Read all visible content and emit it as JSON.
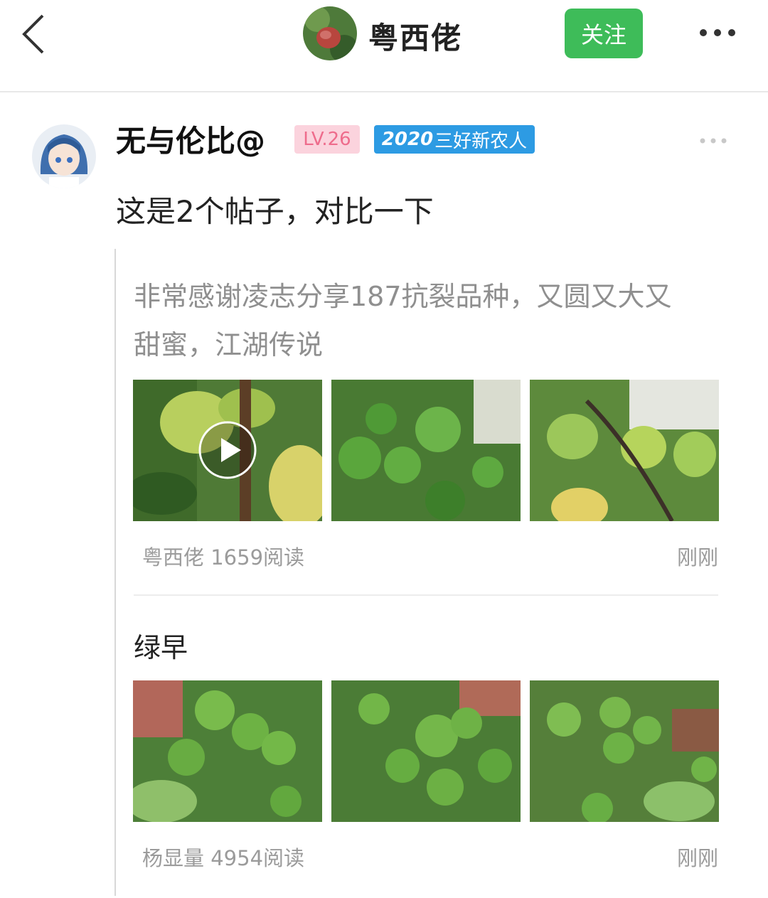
{
  "header": {
    "title": "粤西佬",
    "follow_label": "关注"
  },
  "post": {
    "username": "无与伦比@",
    "level_badge": "LV.26",
    "title_badge_year": "2020",
    "title_badge_text": "三好新农人",
    "content": "这是2个帖子，对比一下"
  },
  "shared_posts": [
    {
      "text": "非常感谢凌志分享187抗裂品种，又圆又大又甜蜜，江湖传说",
      "author_reads": "粤西佬 1659阅读",
      "time": "刚刚"
    },
    {
      "text": "绿早",
      "author_reads": "杨显量 4954阅读",
      "time": "刚刚"
    }
  ],
  "colors": {
    "accent_green": "#3ebc59",
    "badge_blue": "#2d9be3",
    "badge_pink": "#fbd3dd"
  }
}
